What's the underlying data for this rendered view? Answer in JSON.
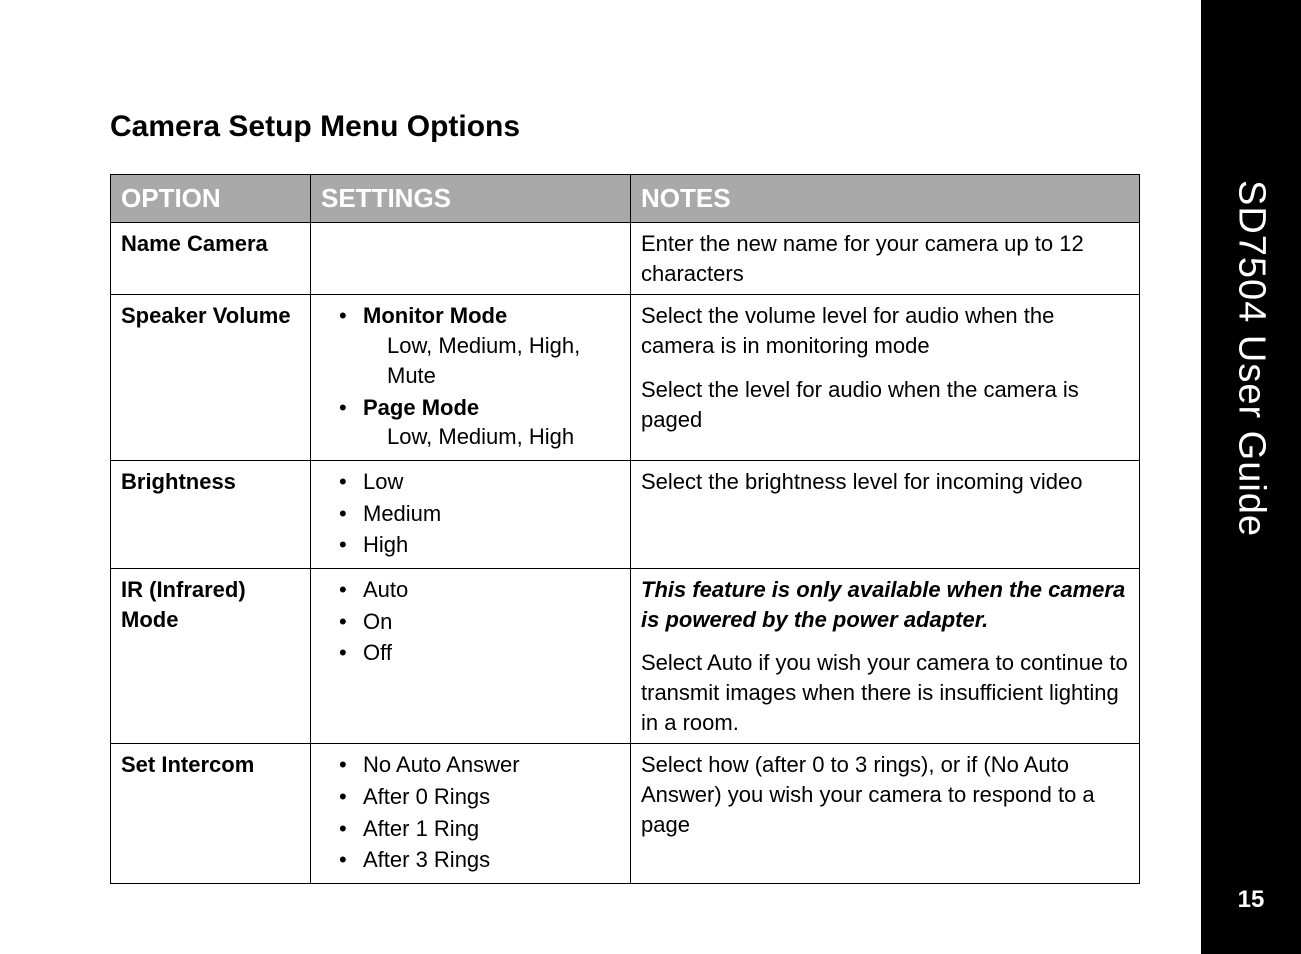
{
  "sideTitle": "SD7504 User Guide",
  "pageNumber": "15",
  "sectionTitle": "Camera Setup Menu Options",
  "table": {
    "headers": {
      "option": "OPTION",
      "settings": "SETTINGS",
      "notes": "NOTES"
    },
    "rows": {
      "nameCamera": {
        "option": "Name Camera",
        "notes": "Enter the new name for your camera up to 12 characters"
      },
      "speakerVolume": {
        "option": "Speaker Volume",
        "settings": {
          "monitorMode": "Monitor Mode",
          "monitorModeValues": "Low, Medium, High, Mute",
          "pageMode": "Page Mode",
          "pageModeValues": "Low, Medium, High"
        },
        "notes1": "Select the volume level for audio when the camera is in monitoring mode",
        "notes2": "Select the level for audio when the camera is paged"
      },
      "brightness": {
        "option": "Brightness",
        "settings": {
          "s1": "Low",
          "s2": "Medium",
          "s3": "High"
        },
        "notes": "Select the brightness level for incoming video"
      },
      "irMode": {
        "option": "IR (Infrared) Mode",
        "settings": {
          "s1": "Auto",
          "s2": "On",
          "s3": "Off"
        },
        "notes1": "This feature is only available when the camera is powered by the power adapter.",
        "notes2": "Select Auto if you wish your camera to continue to transmit images when there is insufficient lighting in a room."
      },
      "setIntercom": {
        "option": "Set Intercom",
        "settings": {
          "s1": "No Auto Answer",
          "s2": "After 0 Rings",
          "s3": "After 1 Ring",
          "s4": "After 3 Rings"
        },
        "notes": "Select how (after 0 to 3 rings), or if (No Auto Answer) you wish your camera to respond to a page"
      }
    }
  }
}
